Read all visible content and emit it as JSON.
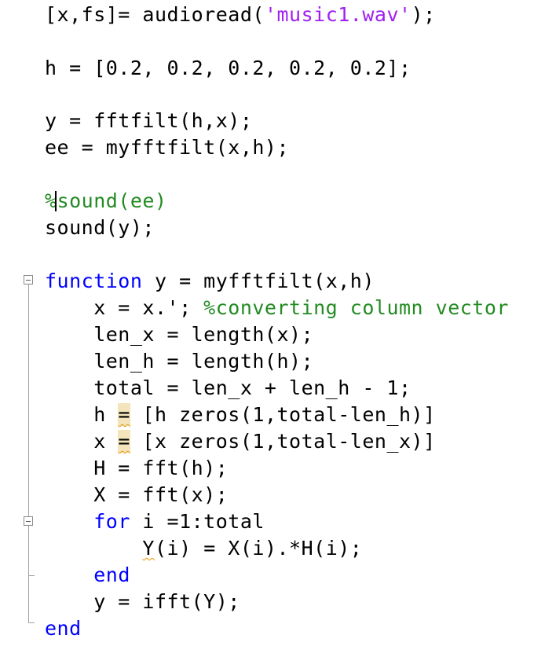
{
  "editor": {
    "lines": {
      "l1": {
        "pre": "[x,fs]= audioread(",
        "str": "'music1.wav'",
        "post": ");"
      },
      "l3": "h = [0.2, 0.2, 0.2, 0.2, 0.2];",
      "l5": "y = fftfilt(h,x);",
      "l6": "ee = myfftfilt(x,h);",
      "l8": {
        "pct": "%",
        "rest": "sound(ee)"
      },
      "l9": "sound(y);",
      "l11": {
        "kw": "function",
        "rest": " y = myfftfilt(x,h)"
      },
      "l12": {
        "code": "    x = x.'; ",
        "comment": "%converting column vector"
      },
      "l13": "    len_x = length(x);",
      "l14": "    len_h = length(h);",
      "l15": "    total = len_x + len_h - 1;",
      "l16": {
        "pre": "    h ",
        "warn": "=",
        "post": " [h zeros(1,total-len_h)]"
      },
      "l17": {
        "pre": "    x ",
        "warn": "=",
        "post": " [x zeros(1,total-len_x)]"
      },
      "l18": "    H = fft(h);",
      "l19": "    X = fft(x);",
      "l20": {
        "indent": "    ",
        "kw": "for",
        "rest": " i =1:total"
      },
      "l21": {
        "indent": "        ",
        "warn": "Y",
        "rest": "(i) = X(i).*H(i);"
      },
      "l22": {
        "indent": "    ",
        "kw": "end"
      },
      "l23": "    y = ifft(Y);",
      "l24": {
        "kw": "end"
      }
    }
  },
  "colors": {
    "keyword": "#0000ff",
    "string": "#a020f0",
    "comment": "#228b22",
    "warning_highlight": "#f3e4bb",
    "warning_squiggle": "#e69500"
  }
}
